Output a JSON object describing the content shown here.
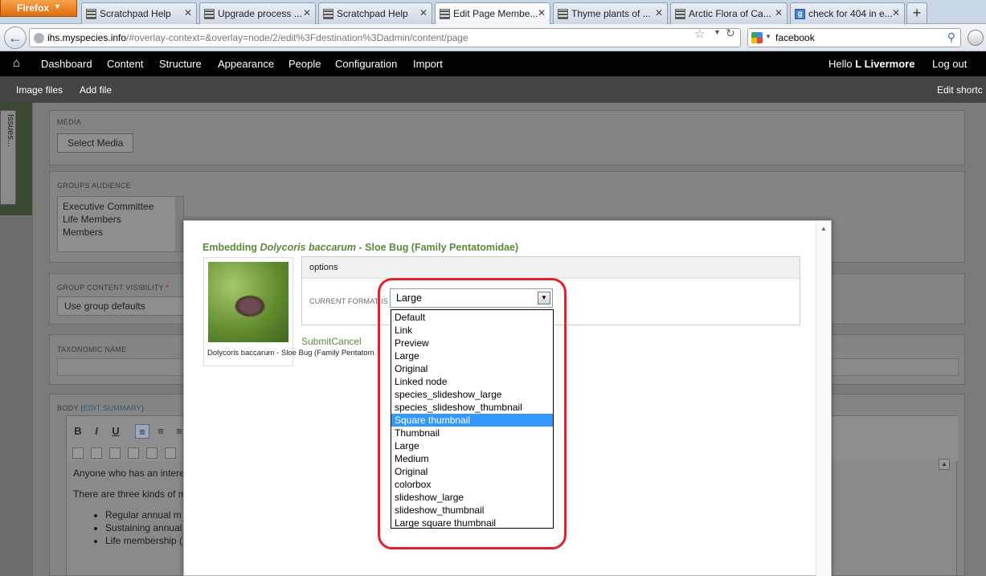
{
  "browser": {
    "app_button": "Firefox",
    "tabs": [
      {
        "label": "Scratchpad Help",
        "active": false,
        "icon": "grid-favicon"
      },
      {
        "label": "Upgrade process ...",
        "active": false,
        "icon": "grid-favicon"
      },
      {
        "label": "Scratchpad Help",
        "active": false,
        "icon": "grid-favicon"
      },
      {
        "label": "Edit Page Membe...",
        "active": true,
        "icon": "grid-favicon"
      },
      {
        "label": "Thyme plants of ...",
        "active": false,
        "icon": "grid-favicon"
      },
      {
        "label": "Arctic Flora of Ca...",
        "active": false,
        "icon": "grid-favicon"
      },
      {
        "label": "check for 404 in e...",
        "active": false,
        "icon": "google-favicon"
      }
    ],
    "new_tab": "+",
    "url_domain": "ihs.myspecies.info",
    "url_rest": "/#overlay-context=&overlay=node/2/edit%3Fdestination%3Dadmin/content/page",
    "search_text": "facebook"
  },
  "toolbar": {
    "home_icon": "home-icon",
    "menu": [
      "Dashboard",
      "Content",
      "Structure",
      "Appearance",
      "People",
      "Configuration",
      "Import"
    ],
    "hello_prefix": "Hello",
    "username": "L Livermore",
    "logout": "Log out"
  },
  "shortcuts": {
    "items": [
      "Image files",
      "Add file"
    ],
    "edit": "Edit shortc"
  },
  "side_tab": {
    "label": "Issues..."
  },
  "form": {
    "media": {
      "legend": "MEDIA",
      "button": "Select Media"
    },
    "groups_audience": {
      "legend": "GROUPS AUDIENCE",
      "options": [
        "Executive Committee",
        "Life Members",
        "Members"
      ]
    },
    "visibility": {
      "legend": "GROUP CONTENT VISIBILITY",
      "required_mark": "*",
      "value": "Use group defaults"
    },
    "taxonomic_name": {
      "legend": "TAXONOMIC NAME"
    },
    "body": {
      "legend": "BODY",
      "edit_summary_open": "(",
      "edit_summary": "EDIT SUMMARY",
      "edit_summary_close": ")",
      "toolbar": [
        "B",
        "I",
        "U"
      ],
      "paragraphs": [
        "Anyone who has an intere",
        "There are three kinds of m"
      ],
      "bullets": [
        "Regular annual m",
        "Sustaining annual",
        "Life membership ("
      ]
    }
  },
  "modal": {
    "title_prefix": "Embedding",
    "title_italic": "Dolycoris baccarum",
    "title_suffix": "- Sloe Bug (Family Pentatomidae)",
    "image_caption": "Dolycoris baccarum - Sloe Bug (Family Pentatom",
    "options_heading": "options",
    "format_label": "CURRENT FORMAT IS",
    "submit": "Submit",
    "cancel": "Cancel"
  },
  "format_select": {
    "value": "Large",
    "highlighted": "Square thumbnail",
    "options": [
      "Default",
      "Link",
      "Preview",
      "Large",
      "Original",
      "Linked node",
      "species_slideshow_large",
      "species_slideshow_thumbnail",
      "Square thumbnail",
      "Thumbnail",
      "Large",
      "Medium",
      "Original",
      "colorbox",
      "slideshow_large",
      "slideshow_thumbnail",
      "Large square thumbnail"
    ]
  },
  "colors": {
    "highlight_ring": "#e4202c",
    "accent_green": "#5a8a3a",
    "selection": "#3399ff"
  }
}
